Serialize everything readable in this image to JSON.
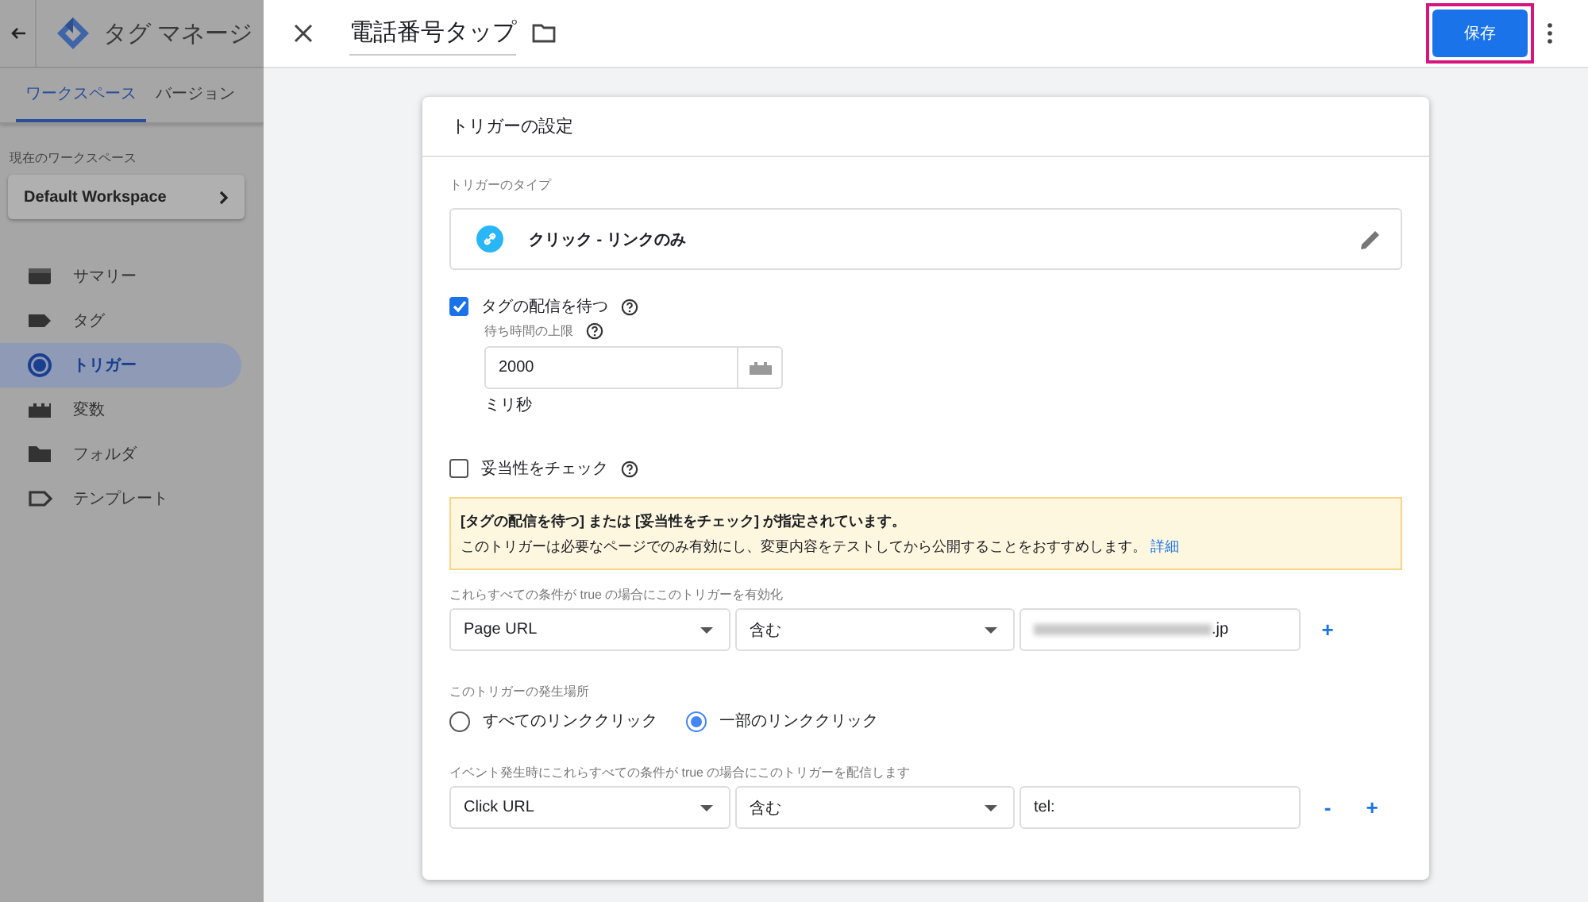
{
  "sidebar": {
    "app_title": "タグ マネージ",
    "tabs": [
      {
        "label": "ワークスペース",
        "selected": true
      },
      {
        "label": "バージョン",
        "selected": false
      }
    ],
    "workspace_label": "現在のワークスペース",
    "workspace": "Default Workspace",
    "items": [
      {
        "label": "サマリー",
        "kind": "summary",
        "selected": false
      },
      {
        "label": "タグ",
        "kind": "tag",
        "selected": false
      },
      {
        "label": "トリガー",
        "kind": "trigger",
        "selected": true
      },
      {
        "label": "変数",
        "kind": "variable",
        "selected": false
      },
      {
        "label": "フォルダ",
        "kind": "folder",
        "selected": false
      },
      {
        "label": "テンプレート",
        "kind": "template",
        "selected": false
      }
    ]
  },
  "editor": {
    "title": "電話番号タップ",
    "save": "保存",
    "save_highlighted": true
  },
  "card": {
    "title": "トリガーの設定",
    "type_label": "トリガーのタイプ",
    "type": "クリック - リンクのみ",
    "wait": {
      "label": "タグの配信を待つ",
      "checked": true,
      "limit_label": "待ち時間の上限",
      "value": "2000",
      "unit": "ミリ秒"
    },
    "validation": {
      "label": "妥当性をチェック",
      "checked": false
    },
    "notice": {
      "title": "[タグの配信を待つ] または [妥当性をチェック] が指定されています。",
      "text": "このトリガーは必要なページでのみ有効にし、変更内容をテストしてから公開することをおすすめします。",
      "link": "詳細"
    },
    "enable_label": "これらすべての条件が true の場合にこのトリガーを有効化",
    "enable_conditions": [
      {
        "variable": "Page URL",
        "operator": "含む",
        "value": ".jp",
        "redacted": true,
        "buttons": [
          "+"
        ]
      }
    ],
    "fire_label": "このトリガーの発生場所",
    "fire_options": [
      {
        "label": "すべてのリンククリック",
        "selected": false
      },
      {
        "label": "一部のリンククリック",
        "selected": true
      }
    ],
    "fire_conditions_label": "イベント発生時にこれらすべての条件が true の場合にこのトリガーを配信します",
    "fire_conditions": [
      {
        "variable": "Click URL",
        "operator": "含む",
        "value": "tel:",
        "redacted": false,
        "buttons": [
          "-",
          "+"
        ]
      }
    ]
  }
}
